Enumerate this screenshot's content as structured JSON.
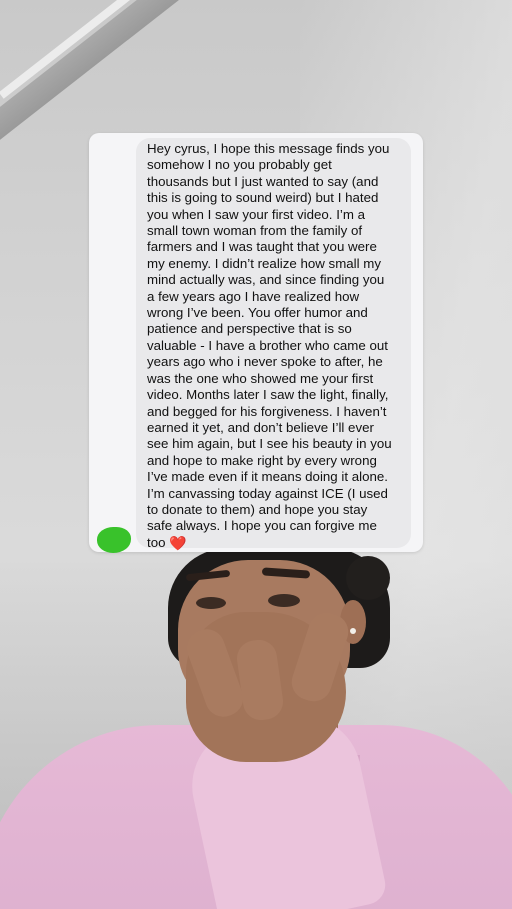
{
  "message": {
    "lines": [
      "Hey cyrus, I hope this message finds you",
      "somehow I no you probably get",
      "thousands but I just wanted to say (and",
      "this is going to sound weird) but I hated",
      "you when I saw your first video. I’m a",
      "small town woman from the family of",
      "farmers and I was taught that you were",
      "my enemy. I didn’t realize how small my",
      "mind actually was, and since finding you",
      "a few years ago I have realized how",
      "wrong I’ve been. You offer humor and",
      "patience and perspective that is so",
      "valuable - I have a brother who came out",
      "years ago who i never spoke to after, he",
      "was the one who showed me your first",
      "video. Months later I saw the light, finally,",
      "and begged for his forgiveness. I haven’t",
      "earned it yet, and don’t believe I’ll ever",
      "see him again, but I see his beauty in you",
      "and hope to make right by every wrong",
      "I’ve made even if it means doing it alone.",
      "I’m canvassing today against ICE (I used",
      "to donate to them) and hope you stay",
      "safe always. I hope you can forgive me"
    ],
    "last_line": "too ",
    "emoji": "❤️",
    "emoji_name": "red-heart-icon"
  },
  "colors": {
    "bubble": "#e9e9eb",
    "card": "#f5f5f7",
    "avatar_scribble": "#39c22b",
    "sweater": "#e6b9d6"
  }
}
